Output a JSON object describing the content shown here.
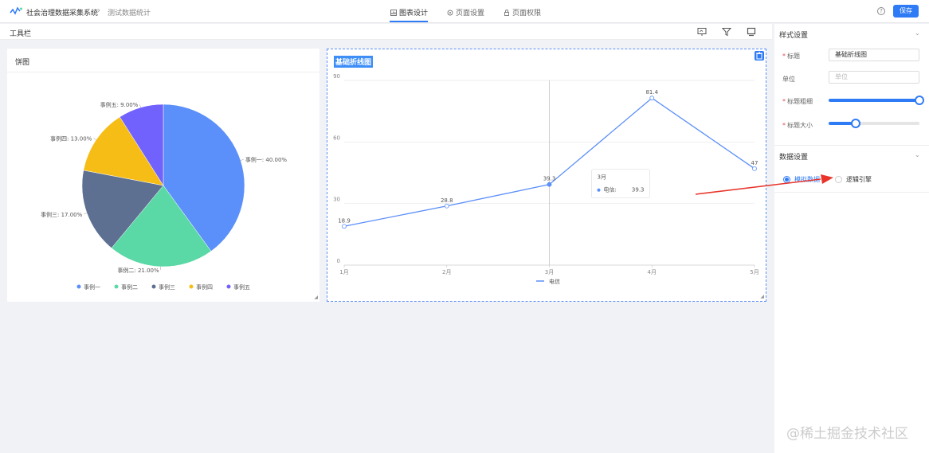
{
  "topbar": {
    "app_title": "社会治理数据采集系统",
    "breadcrumb_sep": "›",
    "breadcrumb_page": "测试数据统计",
    "tabs": [
      {
        "label": "图表设计",
        "icon": "chart-icon"
      },
      {
        "label": "页面设置",
        "icon": "gear-icon"
      },
      {
        "label": "页面权限",
        "icon": "lock-icon"
      }
    ],
    "help": "?",
    "save_label": "保存",
    "accent": "#2f7bf6"
  },
  "toolbar": {
    "label": "工具栏",
    "icons": [
      "presentation-icon",
      "filter-icon",
      "monitor-icon"
    ]
  },
  "pie_card": {
    "title": "饼图",
    "chart_data": {
      "type": "pie",
      "slices": [
        {
          "name": "事例一",
          "value": 40,
          "label": "事例一: 40.00%",
          "color": "#5b8ff9"
        },
        {
          "name": "事例二",
          "value": 21,
          "label": "事例二: 21.00%",
          "color": "#5ad8a6"
        },
        {
          "name": "事例三",
          "value": 17,
          "label": "事例三: 17.00%",
          "color": "#5d7092"
        },
        {
          "name": "事例四",
          "value": 13,
          "label": "事例四: 13.00%",
          "color": "#f6bd16"
        },
        {
          "name": "事例五",
          "value": 9,
          "label": "事例五: 9.00%",
          "color": "#7262fd"
        }
      ],
      "legend": [
        "事例一",
        "事例二",
        "事例三",
        "事例四",
        "事例五"
      ],
      "legend_position": "bottom"
    }
  },
  "line_card": {
    "title": "基础折线图",
    "chart_data": {
      "type": "line",
      "categories": [
        "1月",
        "2月",
        "3月",
        "4月",
        "5月"
      ],
      "series": [
        {
          "name": "电信",
          "values": [
            18.9,
            28.8,
            39.3,
            81.4,
            47
          ],
          "color": "#5b8ff9"
        }
      ],
      "ylim": [
        0,
        90
      ],
      "yticks": [
        "0",
        "30",
        "60",
        "90"
      ],
      "grid": true,
      "legend_position": "bottom",
      "tooltip": {
        "title": "3月",
        "series": "电信:",
        "value": "39.3"
      }
    }
  },
  "right_panel": {
    "style_section": "样式设置",
    "fields": {
      "title_label": "标题",
      "title_value": "基础折线图",
      "unit_label": "单位",
      "unit_placeholder": "单位",
      "title_thick_label": "标题粗细",
      "title_thick_level": 1.0,
      "title_size_label": "标题大小",
      "title_size_level": 0.3
    },
    "data_section": "数据设置",
    "radios": [
      {
        "label": "模拟数据",
        "checked": true
      },
      {
        "label": "逻辑引擎",
        "checked": false
      }
    ]
  },
  "watermark": "@稀土掘金技术社区"
}
